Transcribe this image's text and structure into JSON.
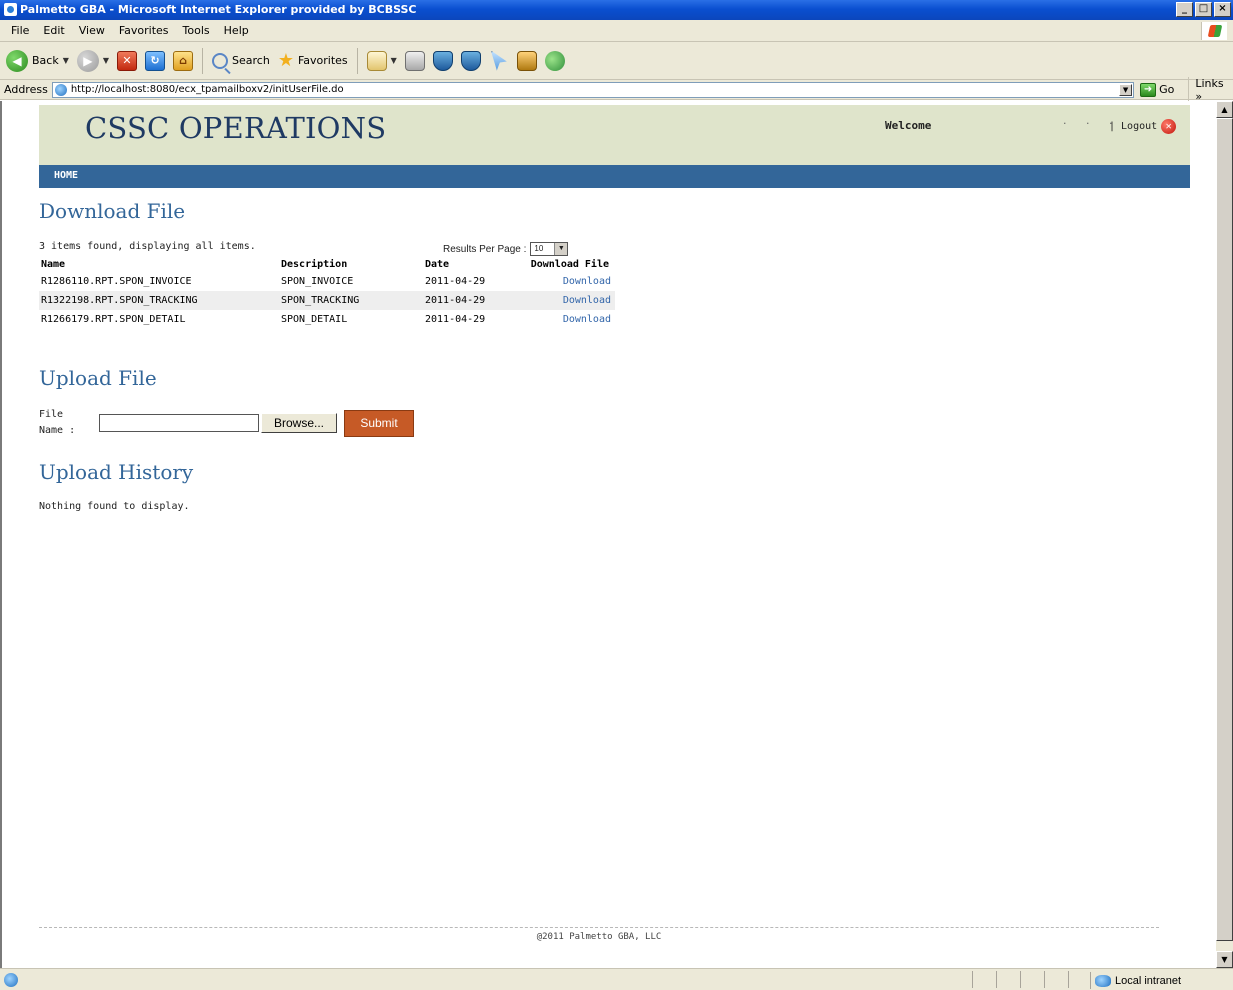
{
  "window": {
    "title": "Palmetto GBA - Microsoft Internet Explorer provided by BCBSSC",
    "minimize": "_",
    "maximize": "□",
    "close": "×"
  },
  "menubar": {
    "items": [
      "File",
      "Edit",
      "View",
      "Favorites",
      "Tools",
      "Help"
    ]
  },
  "toolbar": {
    "back": "Back",
    "search": "Search",
    "favorites": "Favorites"
  },
  "address": {
    "label": "Address",
    "url": "http://localhost:8080/ecx_tpamailboxv2/initUserFile.do",
    "go": "Go",
    "links": "Links »"
  },
  "header": {
    "brand": "CSSC OPERATIONS",
    "welcome": "Welcome",
    "dots": "· · ·",
    "logout": "| Logout"
  },
  "nav": {
    "home": "HOME"
  },
  "download": {
    "title": "Download File",
    "summary": "3 items found, displaying all items.",
    "results_per_page_label": "Results Per Page :",
    "results_per_page_value": "10",
    "columns": [
      "Name",
      "Description",
      "Date",
      "Download File"
    ],
    "rows": [
      {
        "name": "R1286110.RPT.SPON_INVOICE",
        "description": "SPON_INVOICE",
        "date": "2011-04-29",
        "link": "Download"
      },
      {
        "name": "R1322198.RPT.SPON_TRACKING",
        "description": "SPON_TRACKING",
        "date": "2011-04-29",
        "link": "Download"
      },
      {
        "name": "R1266179.RPT.SPON_DETAIL",
        "description": "SPON_DETAIL",
        "date": "2011-04-29",
        "link": "Download"
      }
    ]
  },
  "upload": {
    "title": "Upload File",
    "label_line1": "File",
    "label_line2": "Name :",
    "browse": "Browse...",
    "submit": "Submit"
  },
  "history": {
    "title": "Upload History",
    "empty": "Nothing found to display."
  },
  "footer": {
    "copyright": "@2011 Palmetto GBA, LLC"
  },
  "status": {
    "zone": "Local intranet"
  }
}
